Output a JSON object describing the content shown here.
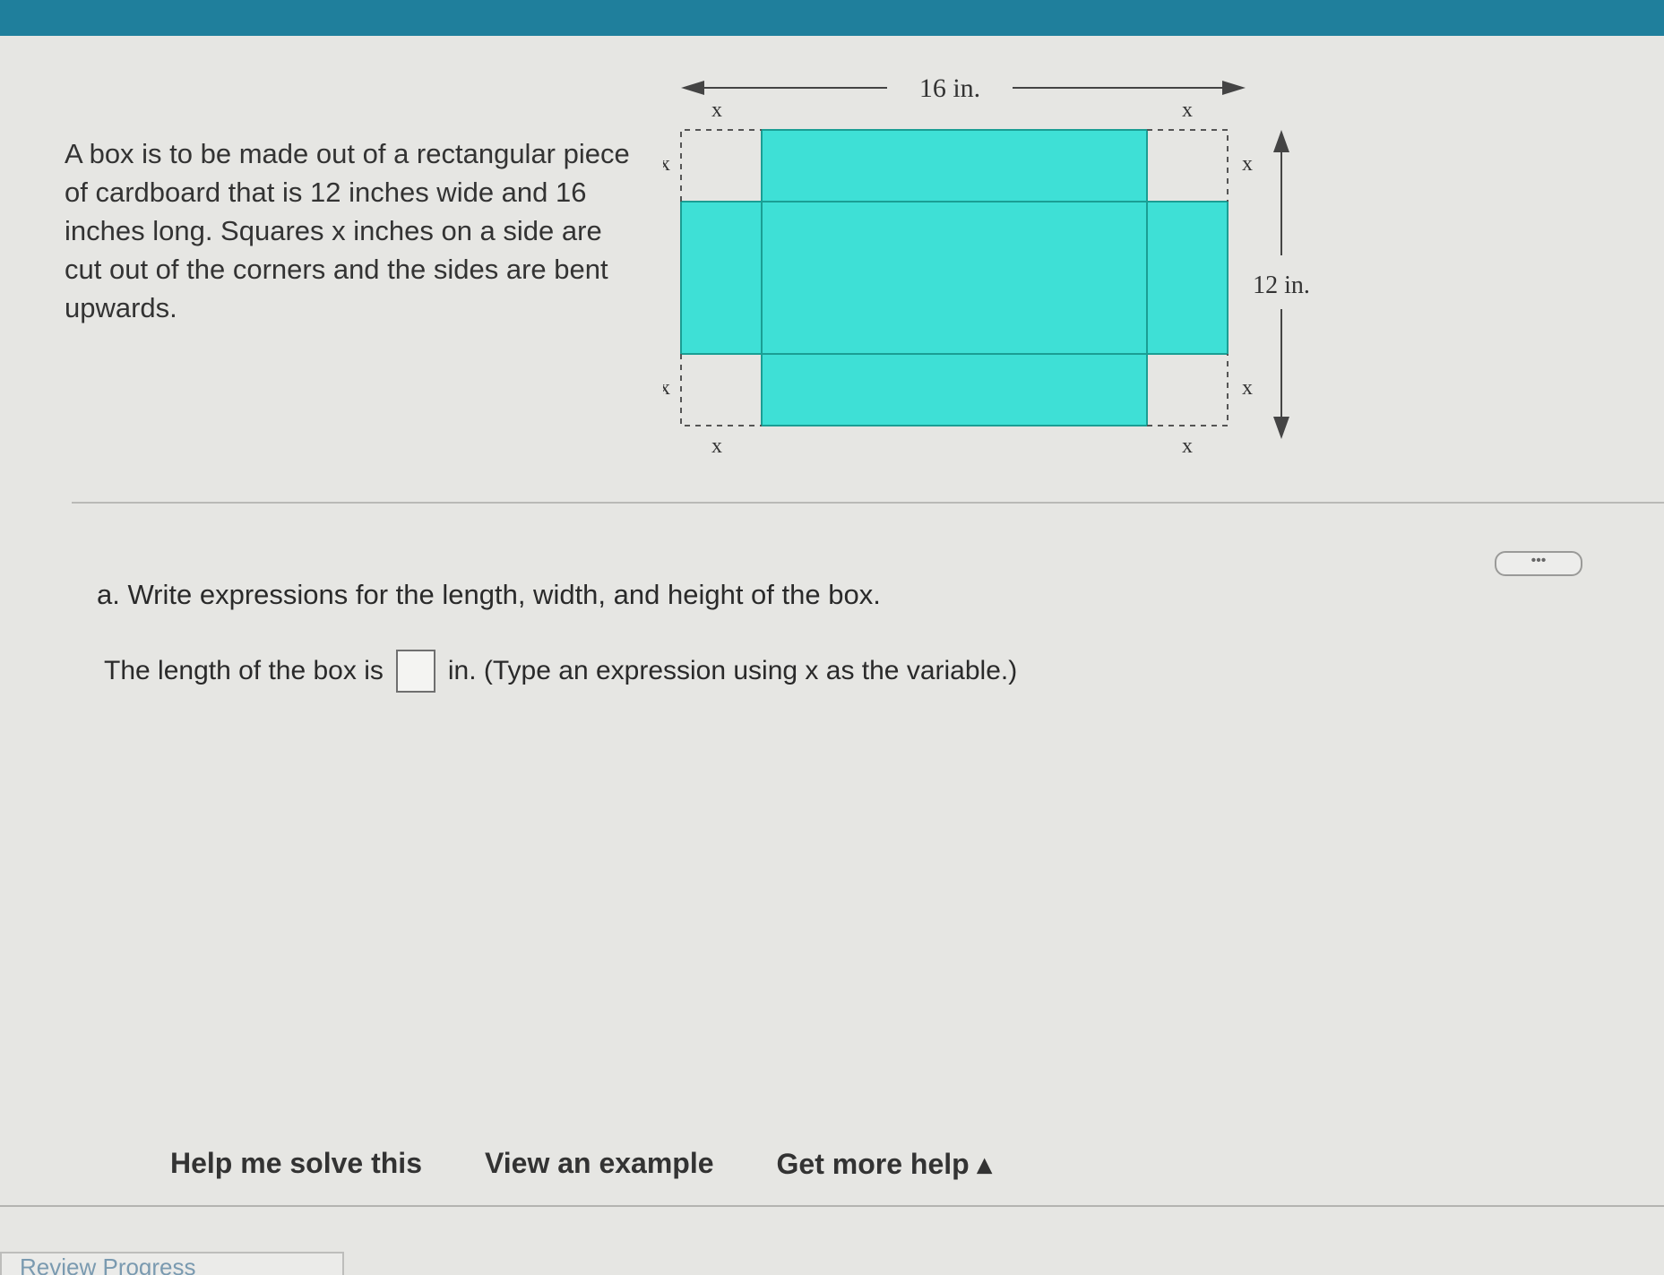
{
  "problem": {
    "text": "A box is to be made out of a rectangular piece of cardboard that is 12 inches wide and 16 inches long. Squares x inches on a side are cut out of the corners and the sides are bent upwards."
  },
  "diagram": {
    "length_label": "16 in.",
    "width_label": "12 in.",
    "x_label": "x",
    "fill_color": "#3ee0d6",
    "stroke_color": "#1a9e94"
  },
  "more_options_label": "•••",
  "question": {
    "part_a": "a. Write expressions for the length, width, and height of the box.",
    "length_prompt": "The length of the box is",
    "length_unit_hint": "in. (Type an expression using x as the variable.)",
    "answer_value": ""
  },
  "help": {
    "solve": "Help me solve this",
    "example": "View an example",
    "more": "Get more help ▴"
  },
  "footer": {
    "review_tab": "Review Progress"
  }
}
